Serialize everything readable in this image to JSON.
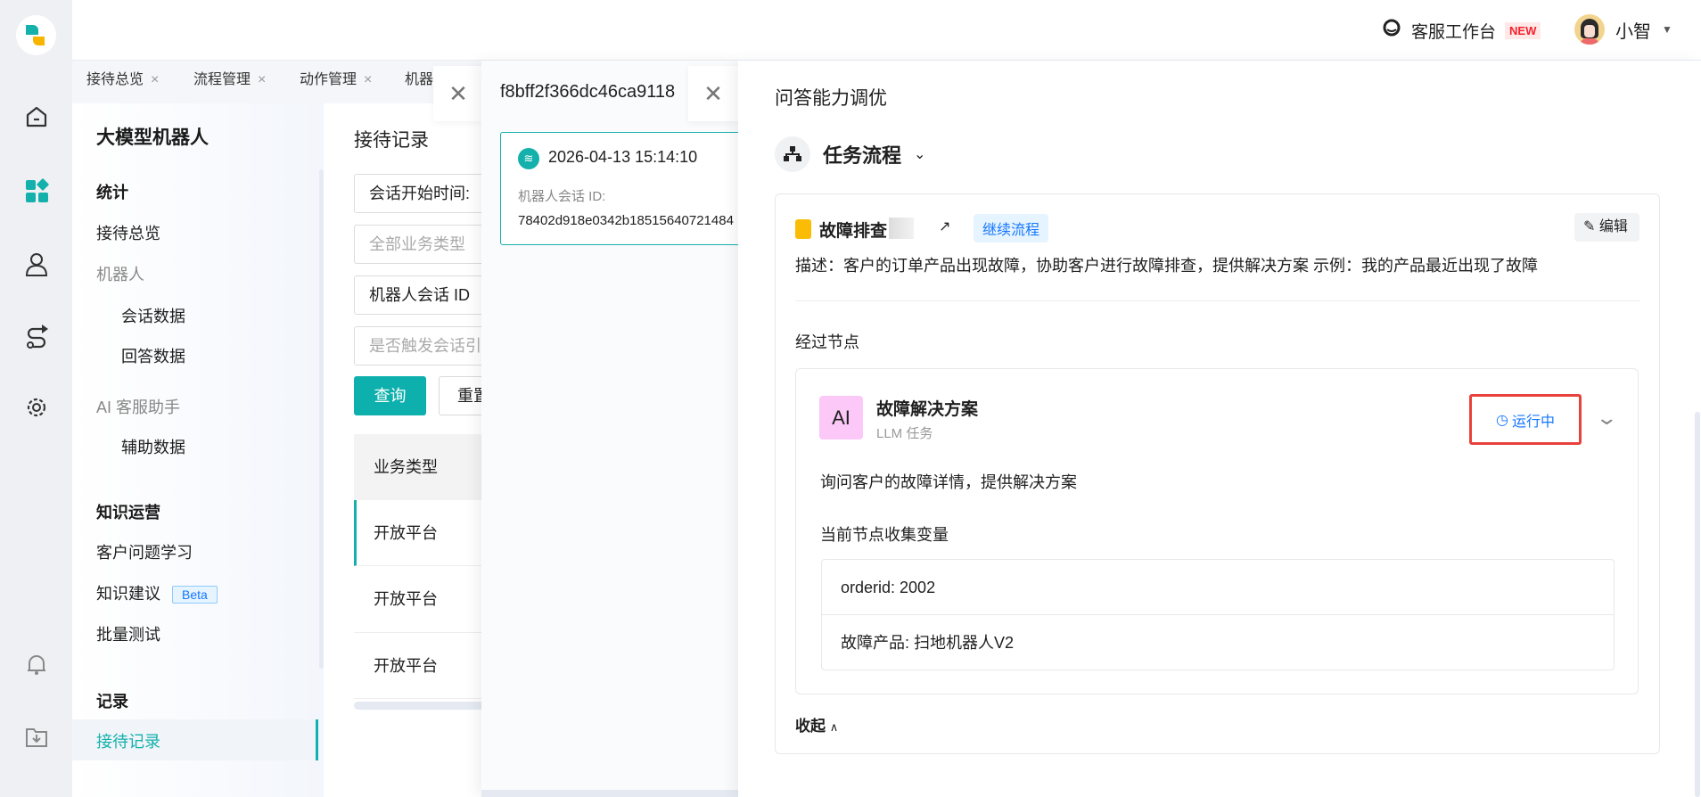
{
  "header": {
    "workbench_label": "客服工作台",
    "new_badge": "NEW",
    "user_name": "小智"
  },
  "tabs": [
    {
      "label": "接待总览"
    },
    {
      "label": "流程管理"
    },
    {
      "label": "动作管理"
    },
    {
      "label": "机器"
    }
  ],
  "tab_close": "×",
  "sidebar": {
    "title": "大模型机器人",
    "sections": [
      {
        "label": "统计"
      },
      {
        "label": "知识运营"
      },
      {
        "label": "记录"
      }
    ],
    "items": {
      "overview": "接待总览",
      "robot": "机器人",
      "session_data": "会话数据",
      "answer_data": "回答数据",
      "ai_assistant": "AI 客服助手",
      "assist_data": "辅助数据",
      "customer_learning": "客户问题学习",
      "knowledge_suggest": "知识建议",
      "beta": "Beta",
      "batch_test": "批量测试",
      "reception_records": "接待记录"
    }
  },
  "main": {
    "title": "接待记录",
    "filters": {
      "start_time": "会话开始时间:",
      "biz_type_placeholder": "全部业务类型",
      "session_id": "机器人会话 ID",
      "trigger_placeholder": "是否触发会话引"
    },
    "query_button": "查询",
    "reset_button": "重置",
    "table": {
      "header": "业务类型",
      "rows": [
        "开放平台",
        "开放平台",
        "开放平台"
      ]
    }
  },
  "session_panel": {
    "title": "f8bff2f366dc46ca9118",
    "time": "2026-04-13 15:14:10",
    "id_label": "机器人会话 ID:",
    "id_value": "78402d918e0342b18515640721484"
  },
  "tuning_panel": {
    "title": "问答能力调优",
    "mode": "任务流程",
    "flow": {
      "name": "故障排查",
      "tag": "继续流程",
      "edit": "编辑",
      "description": "描述：客户的订单产品出现故障，协助客户进行故障排查，提供解决方案 示例：我的产品最近出现了故障"
    },
    "passed_nodes_label": "经过节点",
    "node": {
      "badge": "AI",
      "name": "故障解决方案",
      "type": "LLM 任务",
      "status": "运行中",
      "status_color": "#1677ff",
      "description": "询问客户的故障详情，提供解决方案",
      "vars_label": "当前节点收集变量",
      "variables": [
        "orderid: 2002",
        "故障产品: 扫地机器人V2"
      ]
    },
    "collapse": "收起"
  },
  "colors": {
    "brand": "#14b1ac",
    "highlight_border": "#e8413c",
    "new_badge": "#f5222d"
  }
}
